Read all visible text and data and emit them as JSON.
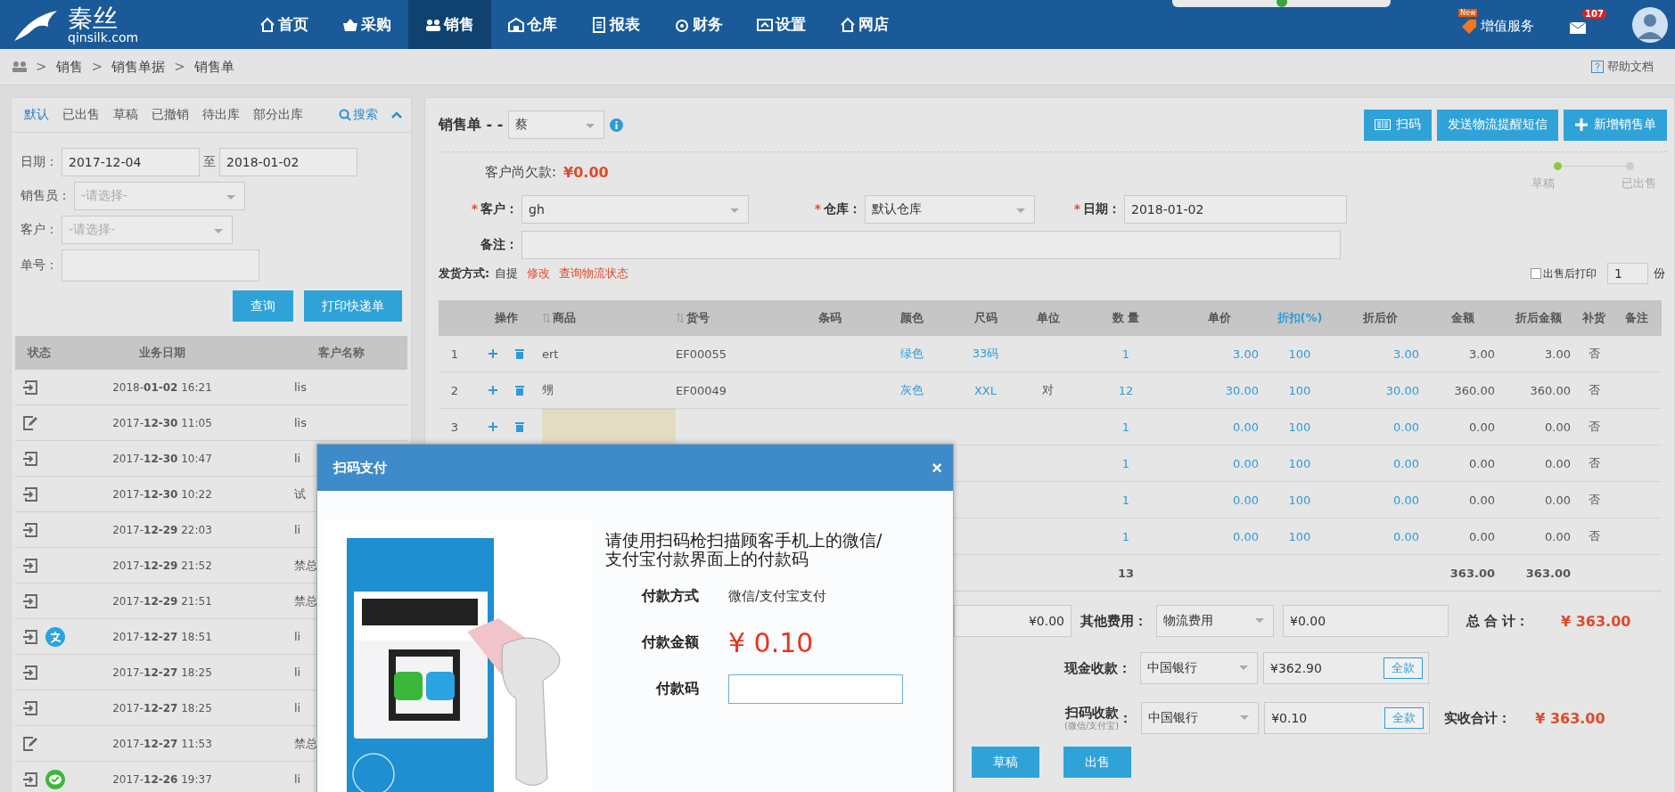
{
  "nav": {
    "logo": "秦丝",
    "logo_sub": "qinsilk.com",
    "items": [
      {
        "label": "首页",
        "selected": false
      },
      {
        "label": "采购",
        "selected": false
      },
      {
        "label": "销售",
        "selected": true
      },
      {
        "label": "仓库",
        "selected": false
      },
      {
        "label": "报表",
        "selected": false
      },
      {
        "label": "财务",
        "selected": false
      },
      {
        "label": "设置",
        "selected": false
      },
      {
        "label": "网店",
        "selected": false
      }
    ],
    "service": {
      "badge": "New",
      "label": "增值服务"
    },
    "mail_count": "107"
  },
  "breadcrumb": {
    "separator": ">",
    "items": [
      "销售",
      "销售单据",
      "销售单"
    ],
    "help": "帮助文档"
  },
  "filter_panel": {
    "tabs": [
      {
        "label": "默认",
        "selected": true
      },
      {
        "label": "已出售",
        "selected": false
      },
      {
        "label": "草稿",
        "selected": false
      },
      {
        "label": "已撤销",
        "selected": false
      },
      {
        "label": "待出库",
        "selected": false
      },
      {
        "label": "部分出库",
        "selected": false
      }
    ],
    "search": "搜索",
    "date": {
      "label": "日期：",
      "from": "2017-12-04",
      "to_label": "至",
      "to": "2018-01-02"
    },
    "salesperson": {
      "label": "销售员：",
      "placeholder": "-请选择-"
    },
    "customer": {
      "label": "客户：",
      "placeholder": "-请选择-"
    },
    "number": {
      "label": "单号："
    },
    "buttons": [
      "查询",
      "打印快递单"
    ]
  },
  "order_list": {
    "columns": [
      "状态",
      "业务日期",
      "客户名称"
    ],
    "rows": [
      {
        "kind": "sold",
        "date": "2018-**01-02** 16:21",
        "customer": "lis"
      },
      {
        "kind": "draft",
        "date": "2017-**12-30** 11:05",
        "customer": "lis"
      },
      {
        "kind": "sold",
        "date": "2017-**12-30** 10:47",
        "customer": "li"
      },
      {
        "kind": "sold",
        "date": "2017-**12-30** 10:22",
        "customer": "试"
      },
      {
        "kind": "sold",
        "date": "2017-**12-29** 22:03",
        "customer": "li"
      },
      {
        "kind": "sold",
        "date": "2017-**12-29** 21:52",
        "customer": "禁总"
      },
      {
        "kind": "sold",
        "date": "2017-**12-29** 21:51",
        "customer": "禁总"
      },
      {
        "kind": "sold",
        "payment": {
          "kind": "alipay"
        },
        "date": "2017-**12-27** 18:51",
        "customer": "li"
      },
      {
        "kind": "sold",
        "date": "2017-**12-27** 18:25",
        "customer": "li"
      },
      {
        "kind": "sold",
        "date": "2017-**12-27** 18:25",
        "customer": "li"
      },
      {
        "kind": "draft",
        "date": "2017-**12-27** 11:53",
        "customer": "禁总"
      },
      {
        "kind": "sold",
        "payment": {
          "kind": "wechat"
        },
        "date": "2017-**12-26** 19:37",
        "customer": "li"
      }
    ]
  },
  "order": {
    "title": "销售单 - -",
    "operator": "蔡",
    "buttons": [
      {
        "kind": "scan",
        "label": "扫码"
      },
      {
        "kind": "plain",
        "label": "发送物流提醒短信"
      },
      {
        "kind": "add",
        "label": "新增销售单"
      }
    ],
    "debt_label": "客户尚欠款:",
    "debt": "¥0.00",
    "steps": [
      {
        "label": "草稿",
        "done": true
      },
      {
        "label": "已出售",
        "done": false
      }
    ],
    "required_mark": "*",
    "customer": {
      "label": "客户：",
      "required": true,
      "value": "gh"
    },
    "warehouse": {
      "label": "仓库：",
      "required": true,
      "value": "默认仓库"
    },
    "date": {
      "label": "日期：",
      "required": true,
      "value": "2018-01-02"
    },
    "note": {
      "label": "备注："
    },
    "shipping": {
      "label": "发货方式:",
      "value": "自提",
      "links": [
        "修改",
        "查询物流状态"
      ]
    },
    "print_after": {
      "label": "出售后打印",
      "checked": false,
      "copies": "1",
      "unit": "份"
    }
  },
  "items_table": {
    "columns": [
      {},
      {
        "label": "操作",
        "sortable": false,
        "link": false
      },
      {
        "label": "商品",
        "sortable": true,
        "link": false
      },
      {
        "label": "货号",
        "sortable": true,
        "link": false
      },
      {
        "label": "条码",
        "sortable": false,
        "link": false
      },
      {
        "label": "颜色",
        "sortable": false,
        "link": false
      },
      {
        "label": "尺码",
        "sortable": false,
        "link": false
      },
      {
        "label": "单位",
        "sortable": false,
        "link": false
      },
      {
        "label": "数 量",
        "sortable": false,
        "link": false
      },
      {
        "label": "单价",
        "sortable": false,
        "link": false
      },
      {
        "label": "折扣(%)",
        "sortable": false,
        "link": true
      },
      {
        "label": "折后价",
        "sortable": false,
        "link": false
      },
      {
        "label": "金额",
        "sortable": false,
        "link": false
      },
      {
        "label": "折后金额",
        "sortable": false,
        "link": false
      },
      {
        "label": "补货",
        "sortable": false,
        "link": false
      },
      {
        "label": "备注",
        "sortable": false,
        "link": false
      }
    ],
    "rows": [
      {
        "actions": true,
        "editing": false,
        "cells": [
          "1",
          "",
          "ert",
          "EF00055",
          "",
          "绿色",
          "33码",
          "",
          "1",
          "3.00",
          "100",
          "3.00",
          "3.00",
          "3.00",
          "否",
          ""
        ]
      },
      {
        "actions": true,
        "editing": false,
        "cells": [
          "2",
          "",
          "甥",
          "EF00049",
          "",
          "灰色",
          "XXL",
          "对",
          "12",
          "30.00",
          "100",
          "30.00",
          "360.00",
          "360.00",
          "否",
          ""
        ]
      },
      {
        "actions": true,
        "editing": true,
        "cells": [
          "3",
          "",
          "",
          "",
          "",
          "",
          "",
          "",
          "1",
          "0.00",
          "100",
          "0.00",
          "0.00",
          "0.00",
          "否",
          ""
        ]
      },
      {
        "cells": [
          "",
          "",
          "",
          "",
          "",
          "",
          "",
          "",
          "1",
          "0.00",
          "100",
          "0.00",
          "0.00",
          "0.00",
          "否",
          ""
        ]
      },
      {
        "cells": [
          "",
          "",
          "",
          "",
          "",
          "",
          "",
          "",
          "1",
          "0.00",
          "100",
          "0.00",
          "0.00",
          "0.00",
          "否",
          ""
        ]
      },
      {
        "cells": [
          "",
          "",
          "",
          "",
          "",
          "",
          "",
          "",
          "1",
          "0.00",
          "100",
          "0.00",
          "0.00",
          "0.00",
          "否",
          ""
        ]
      }
    ],
    "totals": {
      "quantity": "13",
      "amount": "363.00",
      "net_amount": "363.00"
    }
  },
  "payment": {
    "discount_value": "¥0.00",
    "other_fee": {
      "label": "其他费用：",
      "type": "物流费用",
      "value": "¥0.00"
    },
    "total": {
      "label": "总 合 计：",
      "value": "¥ 363.00"
    },
    "cash": {
      "label": "现金收款：",
      "account": "中国银行",
      "value": "¥362.90",
      "button": "全款"
    },
    "scan": {
      "label": "扫码收款",
      "sublabel": "(微信/支付宝)",
      "colon": "：",
      "account": "中国银行",
      "value": "¥0.10",
      "button": "全款"
    },
    "received": {
      "label": "实收合计：",
      "value": "¥ 363.00"
    },
    "buttons": [
      "草稿",
      "出售"
    ]
  },
  "scan_dialog": {
    "title": "扫码支付",
    "close": "×",
    "instruction": "请使用扫码枪扫描顾客手机上的微信/支付宝付款界面上的付款码",
    "method_label": "付款方式",
    "method": "微信/支付宝支付",
    "amount_label": "付款金额",
    "amount": "¥ 0.10",
    "code_label": "付款码"
  }
}
